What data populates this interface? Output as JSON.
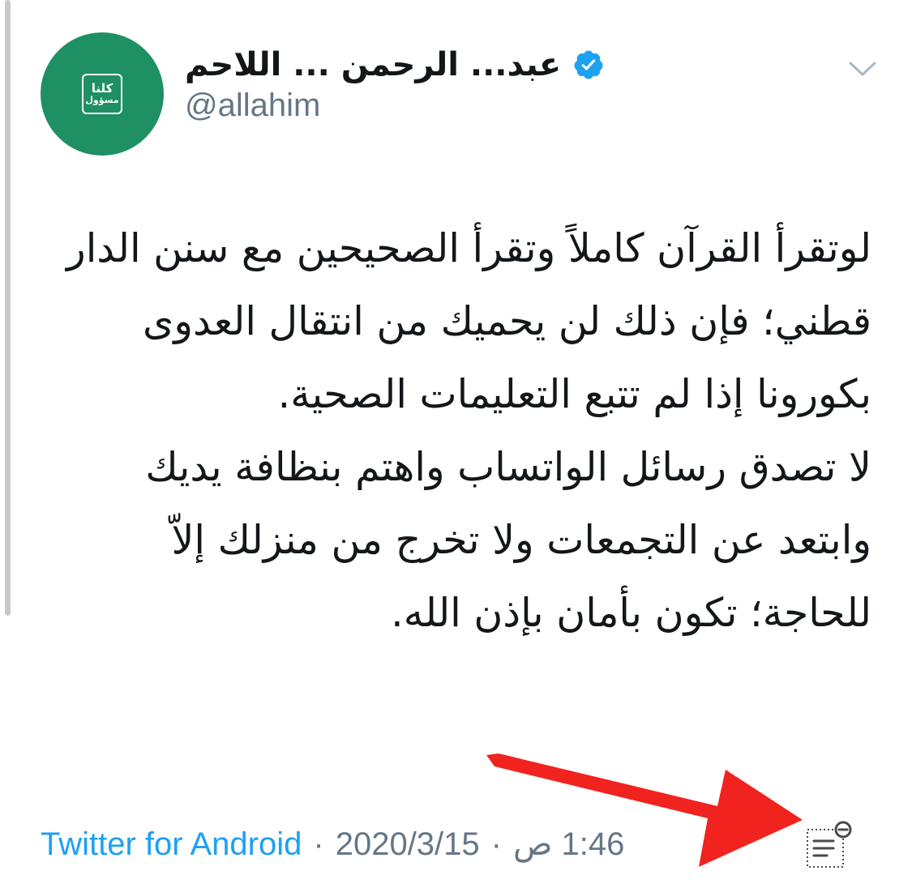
{
  "tweet": {
    "author": {
      "display_name": "عبد... الرحمن ... اللاحم",
      "handle": "@allahim",
      "verified": true,
      "avatar": {
        "bg_color": "#1e9063",
        "logo_line1": "كلنا",
        "logo_line2": "مسؤول"
      }
    },
    "text_paragraphs": [
      "لوتقرأ القرآن كاملاً وتقرأ الصحيحين مع سنن الدار قطني؛ فإن ذلك لن يحميك من انتقال العدوى بكورونا إذا لم تتبع التعليمات الصحية.",
      "لا تصدق رسائل الواتساب واهتم بنظافة يديك وابتعد عن التجمعات ولا تخرج من منزلك إلاّ للحاجة؛ تكون بأمان بإذن الله."
    ],
    "meta": {
      "source": "Twitter for Android",
      "date": "2020/3/15",
      "time": "1:46 ص",
      "separator": "·"
    }
  },
  "colors": {
    "link": "#1da1f2",
    "secondary_text": "#657786",
    "verified": "#1da1f2",
    "annotation_arrow": "#f0231f"
  },
  "icons": {
    "verified": "verified-badge-icon",
    "menu": "chevron-down-icon",
    "analytics": "tweet-activity-icon",
    "annotation": "red-arrow"
  }
}
